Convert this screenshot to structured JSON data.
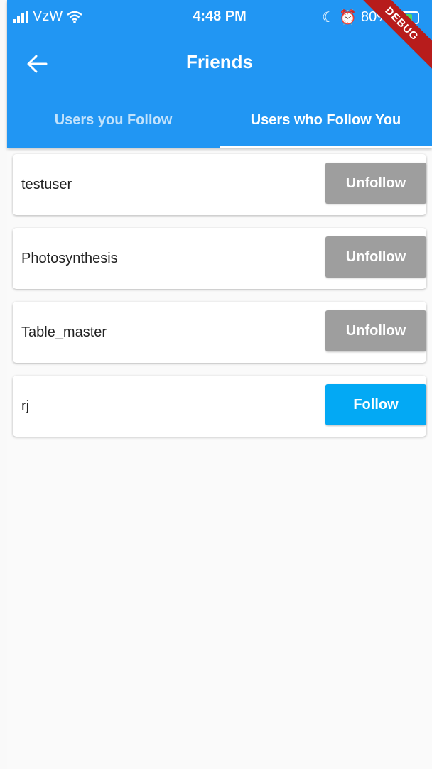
{
  "status_bar": {
    "carrier": "VzW",
    "time": "4:48 PM",
    "battery": "80%",
    "debug_banner": "DEBUG"
  },
  "app_bar": {
    "title": "Friends"
  },
  "tabs": [
    {
      "label": "Users you Follow",
      "active": false
    },
    {
      "label": "Users who Follow You",
      "active": true
    }
  ],
  "users": [
    {
      "name": "testuser",
      "action": "Unfollow"
    },
    {
      "name": "Photosynthesis",
      "action": "Unfollow"
    },
    {
      "name": "Table_master",
      "action": "Unfollow"
    },
    {
      "name": "rj",
      "action": "Follow"
    }
  ],
  "colors": {
    "primary": "#2196f3",
    "unfollow_button": "#9e9e9e",
    "follow_button": "#03a9f4"
  }
}
